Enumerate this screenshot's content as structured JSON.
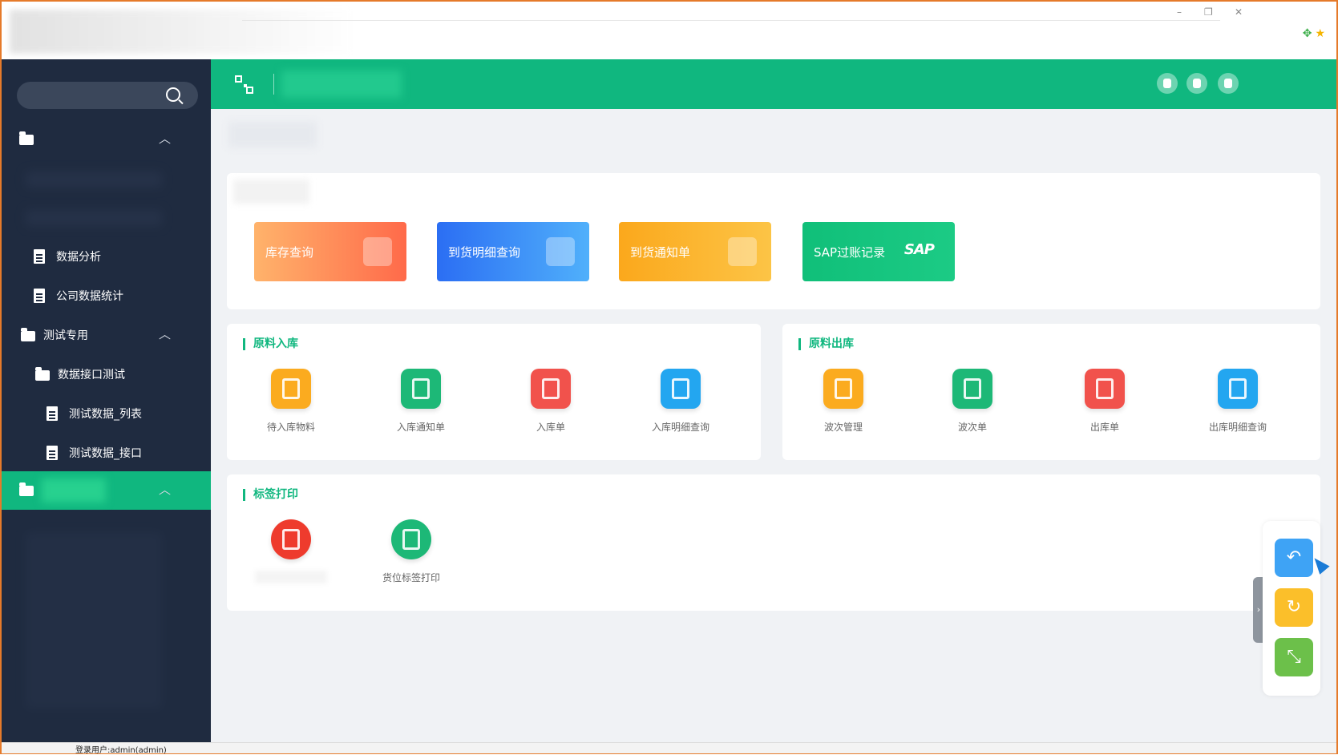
{
  "window": {
    "minimize": "–",
    "restore": "❐",
    "close": "✕"
  },
  "sidebar": {
    "items": [
      {
        "label": "数据分析",
        "icon": "document-icon"
      },
      {
        "label": "公司数据统计",
        "icon": "document-icon"
      },
      {
        "label": "测试专用",
        "icon": "folder-icon",
        "expanded": true
      },
      {
        "label": "数据接口测试",
        "icon": "folder-icon"
      },
      {
        "label": "测试数据_列表",
        "icon": "document-icon"
      },
      {
        "label": "测试数据_接口",
        "icon": "document-icon"
      }
    ]
  },
  "quick_actions": [
    {
      "label": "库存查询",
      "color": "#ff7a45"
    },
    {
      "label": "到货明细查询",
      "color": "#2f7cf6"
    },
    {
      "label": "到货通知单",
      "color": "#fbab1f"
    },
    {
      "label": "SAP过账记录",
      "color": "#12c27e",
      "badge": "SAP"
    }
  ],
  "sections": {
    "inbound": {
      "title": "原料入库",
      "apps": [
        {
          "label": "待入库物料",
          "color": "#fbab1f"
        },
        {
          "label": "入库通知单",
          "color": "#1db877"
        },
        {
          "label": "入库单",
          "color": "#f1524c"
        },
        {
          "label": "入库明细查询",
          "color": "#23a6f0"
        }
      ]
    },
    "outbound": {
      "title": "原料出库",
      "apps": [
        {
          "label": "波次管理",
          "color": "#fbab1f"
        },
        {
          "label": "波次单",
          "color": "#1db877"
        },
        {
          "label": "出库单",
          "color": "#f1524c"
        },
        {
          "label": "出库明细查询",
          "color": "#23a6f0"
        }
      ]
    },
    "labels": {
      "title": "标签打印",
      "apps": [
        {
          "label": "",
          "color": "#ee3b2d"
        },
        {
          "label": "货位标签打印",
          "color": "#1db877"
        }
      ]
    }
  },
  "float_buttons": [
    {
      "name": "back",
      "glyph": "↶",
      "color": "#3ea3f5"
    },
    {
      "name": "refresh",
      "glyph": "↻",
      "color": "#fbbf2a"
    },
    {
      "name": "fullscreen",
      "glyph": "⤡",
      "color": "#6cc04a"
    }
  ],
  "status_bar": {
    "text": "登录用户:admin(admin)"
  },
  "theme": {
    "accent": "#10b77f",
    "sidebar": "#1f2b40"
  }
}
